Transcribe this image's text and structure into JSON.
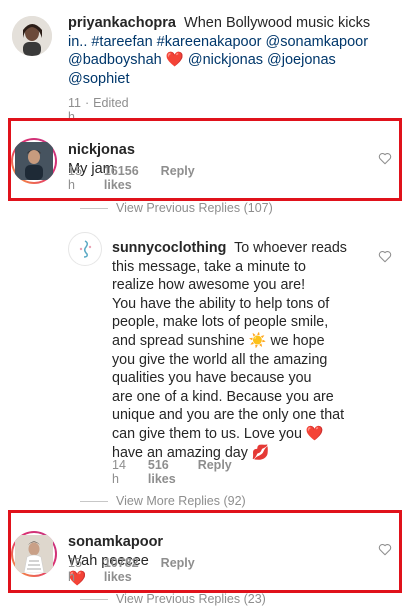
{
  "caption": {
    "username": "priyankachopra",
    "text_lines": [
      "When Bollywood music kicks",
      "in.. #tareefan #kareenakapoor @sonamkapoor",
      "@badboyshah ❤️ @nickjonas @joejonas",
      "@sophiet"
    ],
    "time": "11 h",
    "edited": "Edited"
  },
  "comments": [
    {
      "username": "nickjonas",
      "text": "My jam",
      "time": "15 h",
      "likes": "16156 likes",
      "reply": "Reply"
    },
    {
      "username": "sunnycoclothing",
      "text_lines": [
        "To whoever reads",
        "this message, take a minute to",
        "realize how awesome you are!",
        "You have the ability to help tons of",
        "people, make lots of people smile,",
        "and spread sunshine ☀️ we hope",
        "you give the world all the amazing",
        "qualities you have because you",
        "are one of a kind. Because you are",
        "unique and you are the only one that",
        "can give them to us. Love you ❤️",
        "have an amazing day 💋"
      ],
      "time": "14 h",
      "likes": "516 likes",
      "reply": "Reply"
    },
    {
      "username": "sonamkapoor",
      "text": "Wah peecee ❤️",
      "time": "15 h",
      "likes": "10782 likes",
      "reply": "Reply"
    }
  ],
  "view_previous_1": "View Previous Replies (107)",
  "view_more": "View More Replies (92)",
  "view_previous_2": "View Previous Replies (23)",
  "colors": {
    "highlight": "#e0121b",
    "link": "#00376b",
    "muted": "#8e8e8e"
  }
}
